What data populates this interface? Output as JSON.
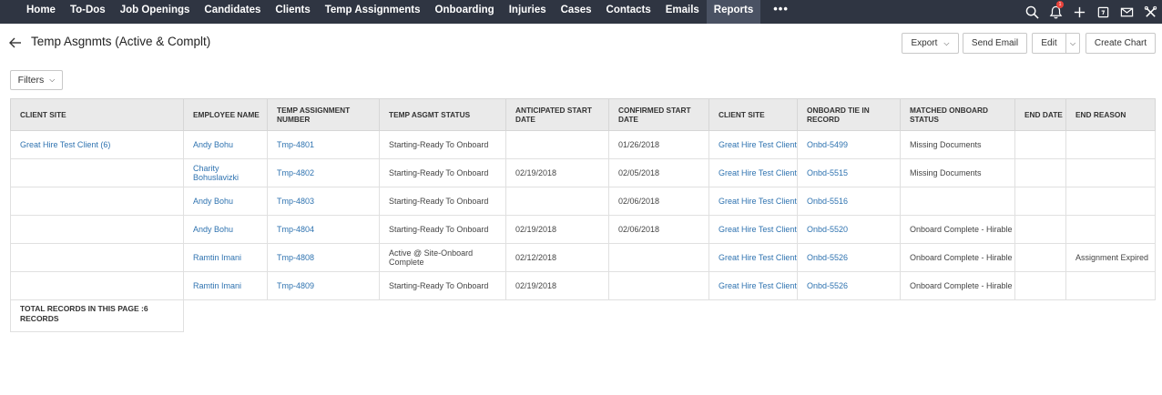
{
  "nav": {
    "items": [
      "Home",
      "To-Dos",
      "Job Openings",
      "Candidates",
      "Clients",
      "Temp Assignments",
      "Onboarding",
      "Injuries",
      "Cases",
      "Contacts",
      "Emails",
      "Reports"
    ],
    "active": "Reports",
    "more": "•••",
    "icons": [
      "search-icon",
      "bell-icon",
      "plus-icon",
      "calendar-icon",
      "mail-icon",
      "tools-icon"
    ],
    "notification_badge": "1"
  },
  "header": {
    "title": "Temp Asgnmts (Active & Complt)",
    "export_label": "Export",
    "send_email_label": "Send Email",
    "edit_label": "Edit",
    "create_chart_label": "Create Chart",
    "filters_label": "Filters"
  },
  "table": {
    "columns": [
      "CLIENT SITE",
      "EMPLOYEE NAME",
      "TEMP ASSIGNMENT NUMBER",
      "TEMP ASGMT STATUS",
      "ANTICIPATED START DATE",
      "CONFIRMED START DATE",
      "CLIENT SITE",
      "ONBOARD TIE IN RECORD",
      "MATCHED ONBOARD STATUS",
      "END DATE",
      "END REASON"
    ],
    "rows": [
      [
        "Great Hire Test Client (6)",
        "Andy Bohu",
        "Tmp-4801",
        "Starting-Ready To Onboard",
        "",
        "01/26/2018",
        "Great Hire Test Client",
        "Onbd-5499",
        "Missing Documents",
        "",
        ""
      ],
      [
        "",
        "Charity Bohuslavizki",
        "Tmp-4802",
        "Starting-Ready To Onboard",
        "02/19/2018",
        "02/05/2018",
        "Great Hire Test Client",
        "Onbd-5515",
        "Missing Documents",
        "",
        ""
      ],
      [
        "",
        "Andy Bohu",
        "Tmp-4803",
        "Starting-Ready To Onboard",
        "",
        "02/06/2018",
        "Great Hire Test Client",
        "Onbd-5516",
        "",
        "",
        ""
      ],
      [
        "",
        "Andy Bohu",
        "Tmp-4804",
        "Starting-Ready To Onboard",
        "02/19/2018",
        "02/06/2018",
        "Great Hire Test Client",
        "Onbd-5520",
        "Onboard Complete - Hirable",
        "",
        ""
      ],
      [
        "",
        "Ramtin Imani",
        "Tmp-4808",
        "Active @ Site-Onboard Complete",
        "02/12/2018",
        "",
        "Great Hire Test Client",
        "Onbd-5526",
        "Onboard Complete - Hirable",
        "",
        "Assignment Expired"
      ],
      [
        "",
        "Ramtin Imani",
        "Tmp-4809",
        "Starting-Ready To Onboard",
        "02/19/2018",
        "",
        "Great Hire Test Client",
        "Onbd-5526",
        "Onboard Complete - Hirable",
        "",
        ""
      ]
    ],
    "total_label": "TOTAL RECORDS IN THIS PAGE :6 RECORDS"
  },
  "colors": {
    "nav_bg": "#2f3542",
    "nav_active_bg": "#4a5263",
    "link": "#2f73b0",
    "header_row_bg": "#eaeaea",
    "badge": "#e8423b"
  }
}
